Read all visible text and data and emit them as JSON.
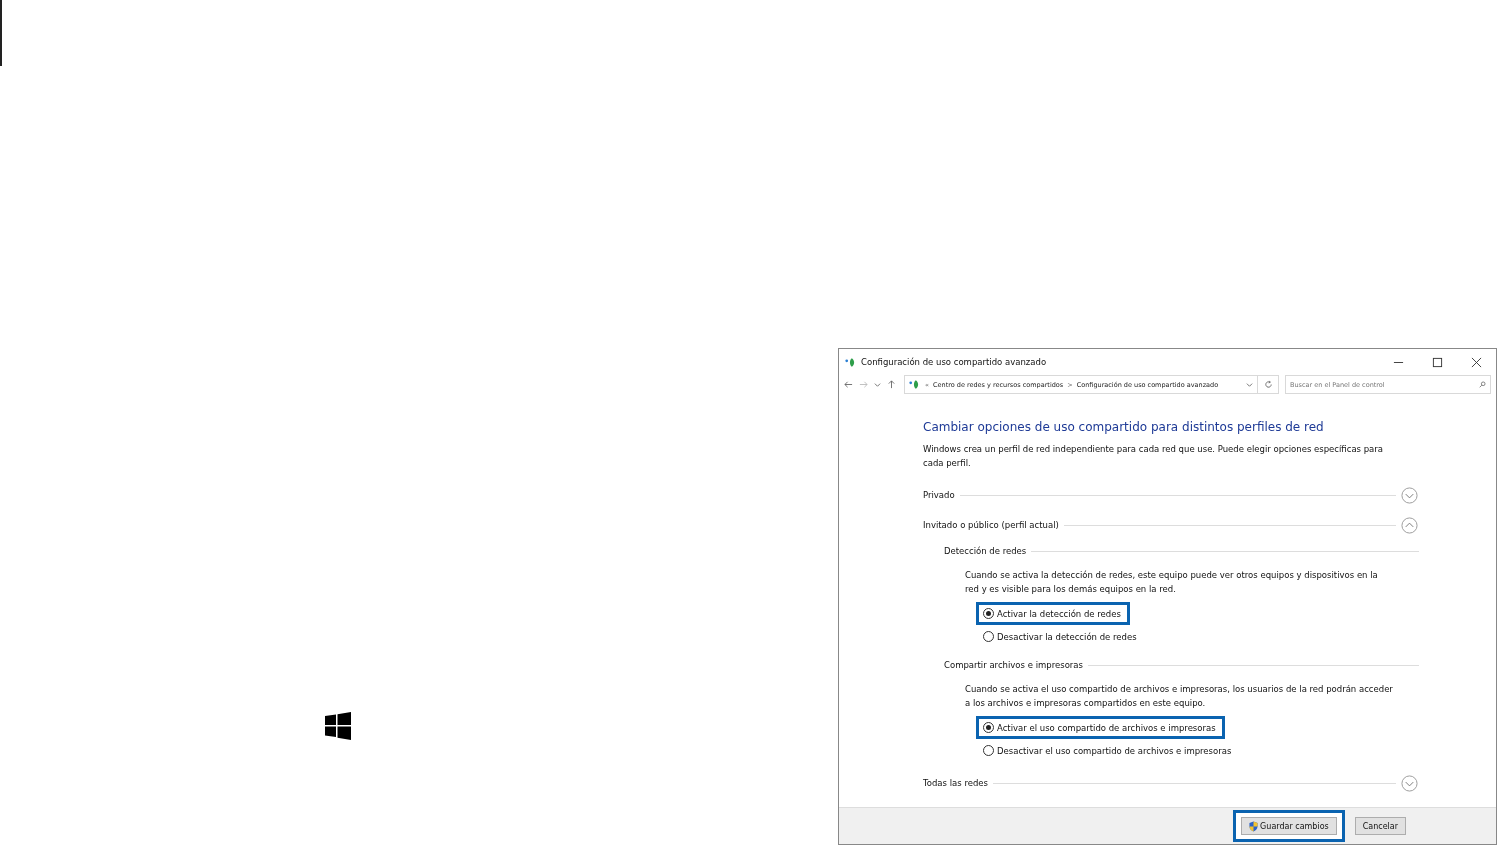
{
  "window": {
    "title": "Configuración de uso compartido avanzado"
  },
  "address_bar": {
    "overflow": "«",
    "breadcrumb": [
      "Centro de redes y recursos compartidos",
      "Configuración de uso compartido avanzado"
    ],
    "separator": ">"
  },
  "search": {
    "placeholder": "Buscar en el Panel de control"
  },
  "heading": "Cambiar opciones de uso compartido para distintos perfiles de red",
  "intro": "Windows crea un perfil de red independiente para cada red que use. Puede elegir opciones específicas para cada perfil.",
  "profiles": [
    {
      "label": "Privado",
      "expanded": false
    },
    {
      "label": "Invitado o público (perfil actual)",
      "expanded": true,
      "groups": [
        {
          "title": "Detección de redes",
          "description": "Cuando se activa la detección de redes, este equipo puede ver otros equipos y dispositivos en la red y es visible para los demás equipos en la red.",
          "options": [
            {
              "label": "Activar la detección de redes",
              "selected": true,
              "highlighted": true
            },
            {
              "label": "Desactivar la detección de redes",
              "selected": false,
              "highlighted": false
            }
          ]
        },
        {
          "title": "Compartir archivos e impresoras",
          "description": "Cuando se activa el uso compartido de archivos e impresoras, los usuarios de la red podrán acceder a los archivos e impresoras compartidos en este equipo.",
          "options": [
            {
              "label": "Activar el uso compartido de archivos e impresoras",
              "selected": true,
              "highlighted": true
            },
            {
              "label": "Desactivar el uso compartido de archivos e impresoras",
              "selected": false,
              "highlighted": false
            }
          ]
        }
      ]
    },
    {
      "label": "Todas las redes",
      "expanded": false
    }
  ],
  "buttons": [
    {
      "label": "Guardar cambios",
      "kind": "shield",
      "highlighted": true
    },
    {
      "label": "Cancelar",
      "kind": "plain",
      "highlighted": false
    }
  ]
}
